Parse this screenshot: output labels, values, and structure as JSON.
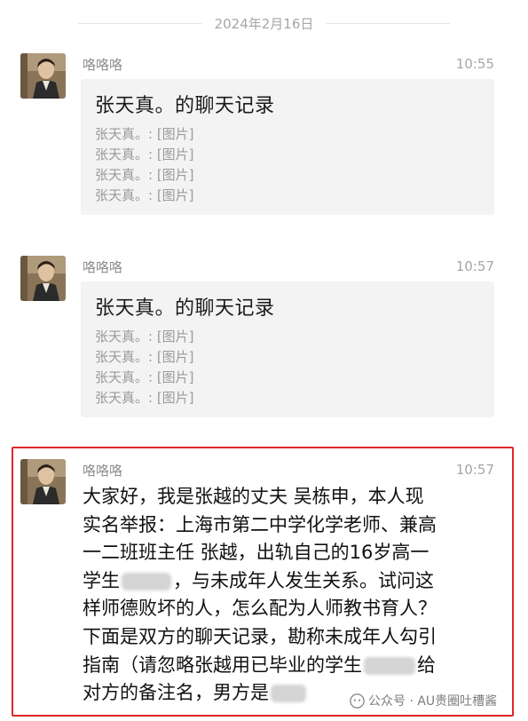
{
  "date_divider": "2024年2月16日",
  "messages": [
    {
      "sender": "咯咯咯",
      "time": "10:55",
      "card": {
        "title": "张天真。的聊天记录",
        "lines": [
          "张天真。: [图片]",
          "张天真。: [图片]",
          "张天真。: [图片]",
          "张天真。: [图片]"
        ]
      }
    },
    {
      "sender": "咯咯咯",
      "time": "10:57",
      "card": {
        "title": "张天真。的聊天记录",
        "lines": [
          "张天真。: [图片]",
          "张天真。: [图片]",
          "张天真。: [图片]",
          "张天真。: [图片]"
        ]
      }
    },
    {
      "sender": "咯咯咯",
      "time": "10:57",
      "text_lines": [
        "大家好，我是张越的丈夫 吴栋申，本人现",
        "实名举报：上海市第二中学化学老师、兼高",
        "一二班班主任 张越，出轨自己的16岁高一",
        "学生",
        "，与未成年人发生关系。试问这",
        "样师德败坏的人，怎么配为人师教书育人？",
        "下面是双方的聊天记录，勘称未成年人勾引",
        "指南（请忽略张越用已毕业的学生",
        "给",
        "对方的备注名，男方是"
      ]
    }
  ],
  "watermark": "公众号 · AU贵圈吐槽酱",
  "colors": {
    "highlight_border": "#e0262a",
    "card_bg": "#f3f3f3",
    "muted_text": "#a6a6a6"
  }
}
